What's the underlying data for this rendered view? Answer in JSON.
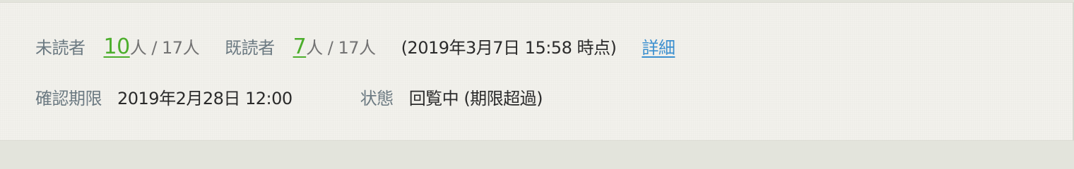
{
  "read_status": {
    "unread_label": "未読者",
    "unread_count": "10",
    "unread_suffix": "人 / 17人",
    "read_label": "既読者",
    "read_count": "7",
    "read_suffix": "人 / 17人",
    "as_of": "(2019年3月7日 15:58 時点)",
    "details_link": "詳細"
  },
  "deadline": {
    "label": "確認期限",
    "value": "2019年2月28日 12:00"
  },
  "status": {
    "label": "状態",
    "value": "回覧中 (期限超過)"
  },
  "colors": {
    "count_green": "#4cae2c",
    "link_blue": "#3a8fcf",
    "label_gray": "#6c7a82"
  }
}
